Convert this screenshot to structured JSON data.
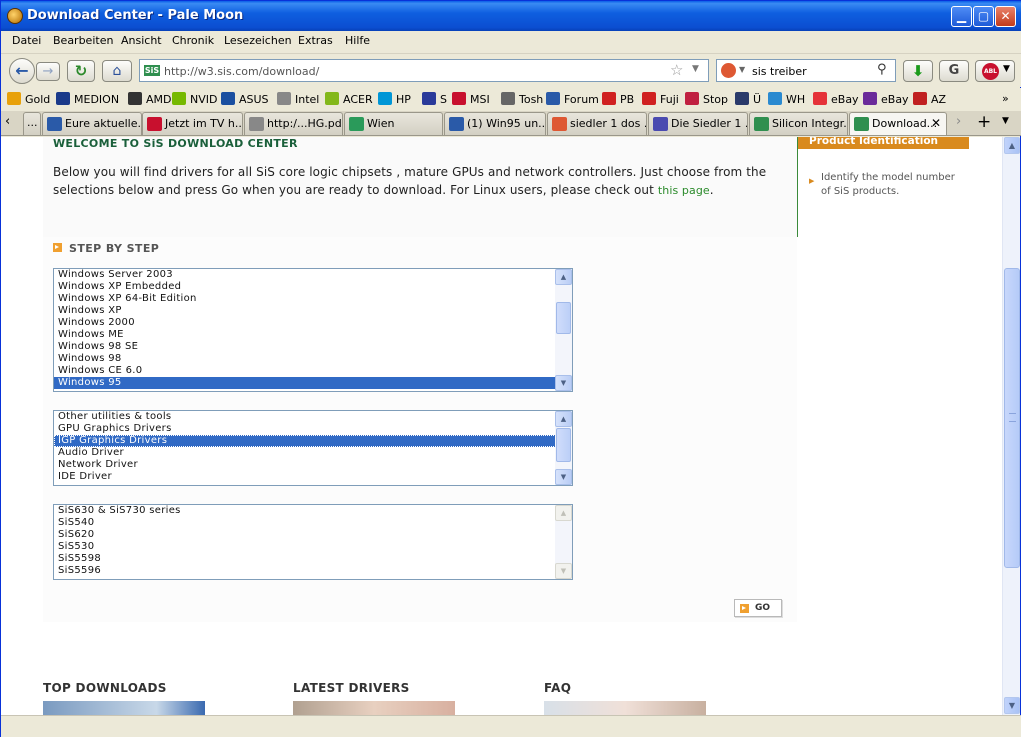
{
  "window": {
    "title": "Download Center - Pale Moon"
  },
  "menu": [
    "Datei",
    "Bearbeiten",
    "Ansicht",
    "Chronik",
    "Lesezeichen",
    "Extras",
    "Hilfe"
  ],
  "nav": {
    "url": "http://w3.sis.com/download/",
    "url_favicon": "SiS",
    "search_value": "sis treiber"
  },
  "bookmarks": [
    {
      "label": "Gold",
      "icon": "gold-icon",
      "color": "#e8a10a"
    },
    {
      "label": "MEDION",
      "icon": "medion-icon",
      "color": "#1a3a8a"
    },
    {
      "label": "AMD",
      "icon": "amd-icon",
      "color": "#333333"
    },
    {
      "label": "NVID",
      "icon": "nvidia-icon",
      "color": "#76b900"
    },
    {
      "label": "ASUS",
      "icon": "asus-icon",
      "color": "#1a4fa0"
    },
    {
      "label": "Intel",
      "icon": "globe-icon",
      "color": "#888888"
    },
    {
      "label": "ACER",
      "icon": "acer-icon",
      "color": "#83b81a"
    },
    {
      "label": "HP",
      "icon": "hp-icon",
      "color": "#0096d6"
    },
    {
      "label": "S",
      "icon": "s-icon",
      "color": "#2a3a9a"
    },
    {
      "label": "MSI",
      "icon": "msi-shield-icon",
      "color": "#c8102e"
    },
    {
      "label": "Tosh",
      "icon": "toshiba-icon",
      "color": "#666666"
    },
    {
      "label": "Forum",
      "icon": "forum-icon",
      "color": "#2a5aa8"
    },
    {
      "label": "PB",
      "icon": "pb-icon",
      "color": "#d02020"
    },
    {
      "label": "Fuji",
      "icon": "fujitsu-icon",
      "color": "#d02020"
    },
    {
      "label": "Stop",
      "icon": "stop-icon",
      "color": "#c02040"
    },
    {
      "label": "Ü",
      "icon": "u-icon",
      "color": "#2a3a6a"
    },
    {
      "label": "WH",
      "icon": "wh-icon",
      "color": "#2a8ad0"
    },
    {
      "label": "eBay",
      "icon": "ebay-icon",
      "color": "#e53238"
    },
    {
      "label": "eBay",
      "icon": "k-icon",
      "color": "#6a2a9a"
    },
    {
      "label": "AZ",
      "icon": "az-chart-icon",
      "color": "#c02020"
    }
  ],
  "tabs": [
    {
      "label": "Eure aktuelle...",
      "icon": "forum-icon",
      "color": "#2a5aa8"
    },
    {
      "label": "Jetzt im TV h...",
      "icon": "tv-icon",
      "color": "#c8102e"
    },
    {
      "label": "http:/...HG.pdf",
      "icon": "globe-icon",
      "color": "#888888"
    },
    {
      "label": "Wien",
      "icon": "m-icon",
      "color": "#2a9a5a"
    },
    {
      "label": "(1) Win95 un...",
      "icon": "forum-icon",
      "color": "#2a5aa8"
    },
    {
      "label": "siedler 1 dos ...",
      "icon": "duckduckgo-icon",
      "color": "#de5833"
    },
    {
      "label": "Die Siedler 1 ...",
      "icon": "site-icon",
      "color": "#4a4ab0"
    },
    {
      "label": "Silicon Integr...",
      "icon": "sis-icon",
      "color": "#2f8f4f"
    },
    {
      "label": "Download...",
      "icon": "sis-icon",
      "color": "#2f8f4f"
    }
  ],
  "page": {
    "welcome": "WELCOME TO SiS DOWNLOAD CENTER",
    "intro": "Below you will find drivers for all SiS core logic chipsets , mature GPUs and network controllers. Just choose from the selections below and press Go when you are ready to download. For Linux users, please check out ",
    "intro_link": "this page",
    "intro_end": ".",
    "sidebar_title": "Product Identification",
    "sidebar_text": "Identify the model number of SiS products.",
    "step_title": "STEP BY STEP",
    "os_list": [
      "Windows Server 2003",
      "Windows XP Embedded",
      "Windows XP 64-Bit Edition",
      "Windows XP",
      "Windows 2000",
      "Windows ME",
      "Windows 98 SE",
      "Windows 98",
      "Windows CE 6.0",
      "Windows 95"
    ],
    "os_selected": "Windows 95",
    "type_list": [
      "Other utilities & tools",
      "GPU Graphics Drivers",
      "IGP Graphics Drivers",
      "Audio Driver",
      "Network Driver",
      "IDE Driver"
    ],
    "type_selected": "IGP Graphics Drivers",
    "chip_list": [
      "SiS630 & SiS730 series",
      "SiS540",
      "SiS620",
      "SiS530",
      "SiS5598",
      "SiS5596"
    ],
    "go_label": "GO",
    "bottom_sections": [
      "TOP DOWNLOADS",
      "LATEST DRIVERS",
      "FAQ"
    ]
  }
}
